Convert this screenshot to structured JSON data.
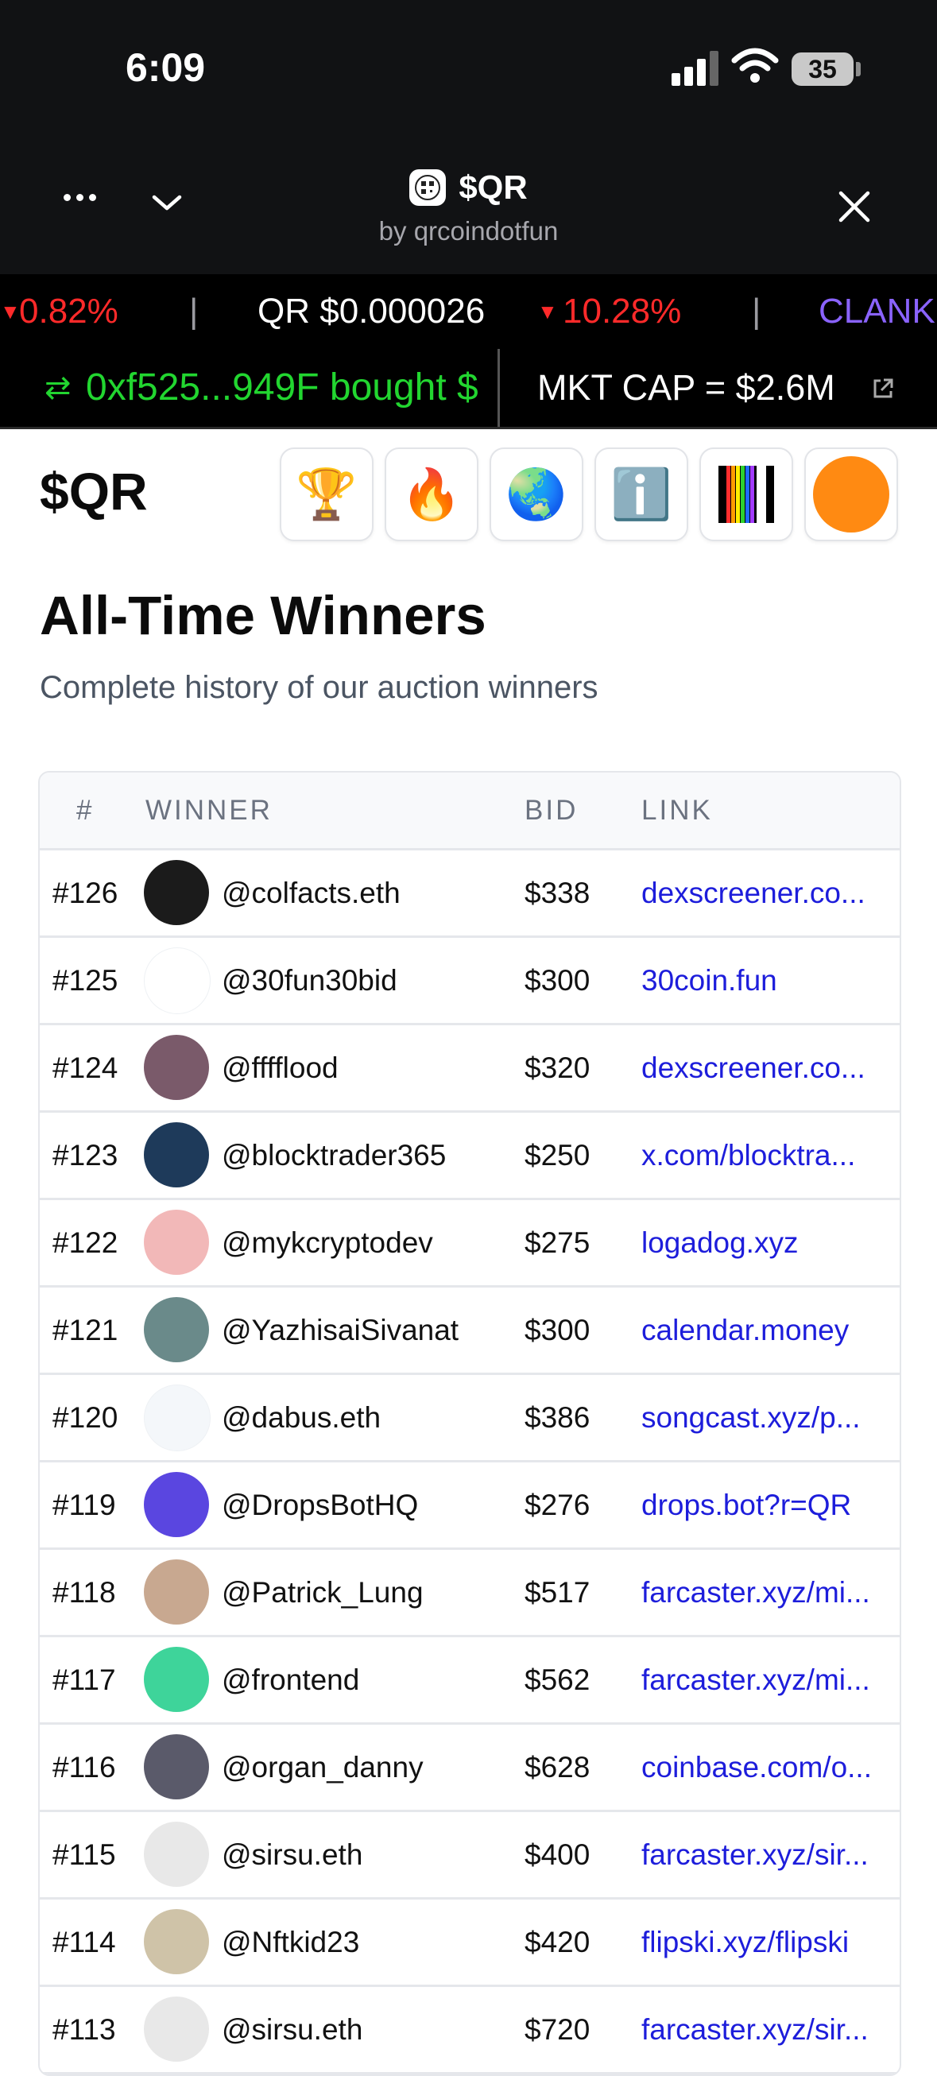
{
  "status": {
    "time": "6:09",
    "battery": "35"
  },
  "nav": {
    "title": "$QR",
    "subtitle": "by qrcoindotfun"
  },
  "ticker": {
    "items": [
      {
        "text": "0.82%",
        "color": "#ff2a2a"
      },
      {
        "text": "|",
        "color": "#9a9aa0"
      },
      {
        "text": "QR $0.000026",
        "color": "#ffffff"
      },
      {
        "text": "10.28%",
        "color": "#ff2a2a"
      },
      {
        "text": "|",
        "color": "#9a9aa0"
      },
      {
        "text": "CLANK",
        "color": "#8a63ff"
      }
    ]
  },
  "feed": {
    "trade": "0xf525...949F bought $",
    "market_cap": "MKT CAP = $2.6M"
  },
  "header": {
    "brand": "$QR",
    "buttons": [
      {
        "name": "trophy-button",
        "icon": "🏆"
      },
      {
        "name": "fire-button",
        "icon": "🔥"
      },
      {
        "name": "globe-button",
        "icon": "🌏"
      },
      {
        "name": "info-button",
        "icon": "ℹ️"
      },
      {
        "name": "color-bars-button",
        "icon": "color-bars-icon"
      },
      {
        "name": "orange-circle-button",
        "icon": "orange-circle-icon"
      }
    ]
  },
  "page": {
    "title": "All-Time Winners",
    "subtitle": "Complete history of our auction winners"
  },
  "table": {
    "headers": {
      "num": "#",
      "winner": "WINNER",
      "bid": "BID",
      "link": "LINK"
    },
    "rows": [
      {
        "num": "#126",
        "name": "@colfacts.eth",
        "bid": "$338",
        "link": "dexscreener.co...",
        "avatar": "#1b1b1b"
      },
      {
        "num": "#125",
        "name": "@30fun30bid",
        "bid": "$300",
        "link": "30coin.fun",
        "avatar": "#ffffff"
      },
      {
        "num": "#124",
        "name": "@fffflood",
        "bid": "$320",
        "link": "dexscreener.co...",
        "avatar": "#7a5a6a"
      },
      {
        "num": "#123",
        "name": "@blocktrader365",
        "bid": "$250",
        "link": "x.com/blocktra...",
        "avatar": "#1e3a5a"
      },
      {
        "num": "#122",
        "name": "@mykcryptodev",
        "bid": "$275",
        "link": "logadog.xyz",
        "avatar": "#f2b8b8"
      },
      {
        "num": "#121",
        "name": "@YazhisaiSivanat",
        "bid": "$300",
        "link": "calendar.money",
        "avatar": "#6a8a8a"
      },
      {
        "num": "#120",
        "name": "@dabus.eth",
        "bid": "$386",
        "link": "songcast.xyz/p...",
        "avatar": "#f4f7fa"
      },
      {
        "num": "#119",
        "name": "@DropsBotHQ",
        "bid": "$276",
        "link": "drops.bot?r=QR",
        "avatar": "#5a46e0"
      },
      {
        "num": "#118",
        "name": "@Patrick_Lung",
        "bid": "$517",
        "link": "farcaster.xyz/mi...",
        "avatar": "#c8a890"
      },
      {
        "num": "#117",
        "name": "@frontend",
        "bid": "$562",
        "link": "farcaster.xyz/mi...",
        "avatar": "#3ed49a"
      },
      {
        "num": "#116",
        "name": "@organ_danny",
        "bid": "$628",
        "link": "coinbase.com/o...",
        "avatar": "#5a5a6a"
      },
      {
        "num": "#115",
        "name": "@sirsu.eth",
        "bid": "$400",
        "link": "farcaster.xyz/sir...",
        "avatar": "#e8e8e8"
      },
      {
        "num": "#114",
        "name": "@Nftkid23",
        "bid": "$420",
        "link": "flipski.xyz/flipski",
        "avatar": "#cfc3a8"
      },
      {
        "num": "#113",
        "name": "@sirsu.eth",
        "bid": "$720",
        "link": "farcaster.xyz/sir...",
        "avatar": "#e8e8e8"
      }
    ]
  }
}
